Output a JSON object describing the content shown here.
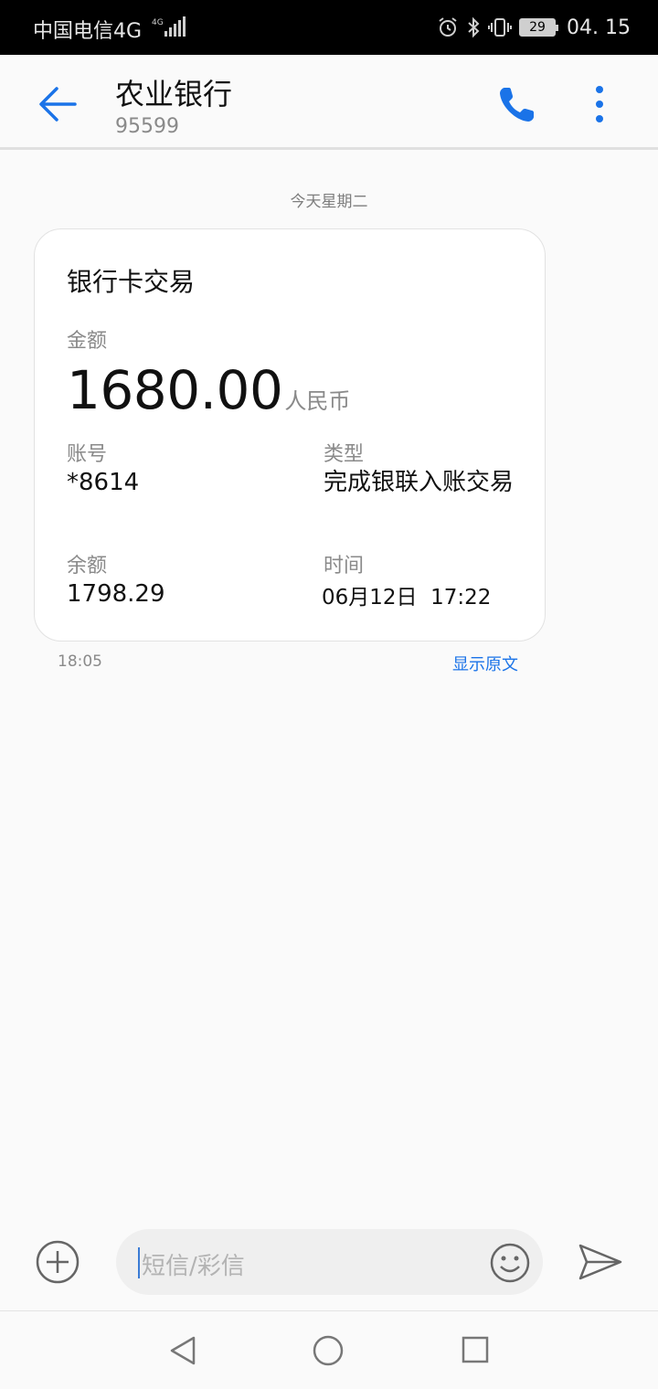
{
  "status_bar": {
    "carrier": "中国电信4G",
    "battery": "29",
    "time": "04. 15"
  },
  "header": {
    "contact_name": "农业银行",
    "contact_number": "95599"
  },
  "conversation": {
    "date_divider": "今天星期二",
    "message": {
      "title": "银行卡交易",
      "amount_label": "金额",
      "amount_value": "1680.00",
      "amount_unit": "人民币",
      "account_label": "账号",
      "account_value": "*8614",
      "type_label": "类型",
      "type_value": "完成银联入账交易",
      "balance_label": "余额",
      "balance_value": "1798.29",
      "time_label": "时间",
      "time_value": "06月12日  17:22",
      "sent_time": "18:05",
      "show_original": "显示原文"
    }
  },
  "composer": {
    "placeholder": "短信/彩信"
  },
  "colors": {
    "accent": "#1a73e8",
    "status_bar_bg": "#000000"
  },
  "icons": [
    "back-arrow-icon",
    "phone-icon",
    "more-vert-icon",
    "plus-circle-icon",
    "emoji-icon",
    "send-icon",
    "nav-back-icon",
    "nav-home-icon",
    "nav-recent-icon"
  ]
}
